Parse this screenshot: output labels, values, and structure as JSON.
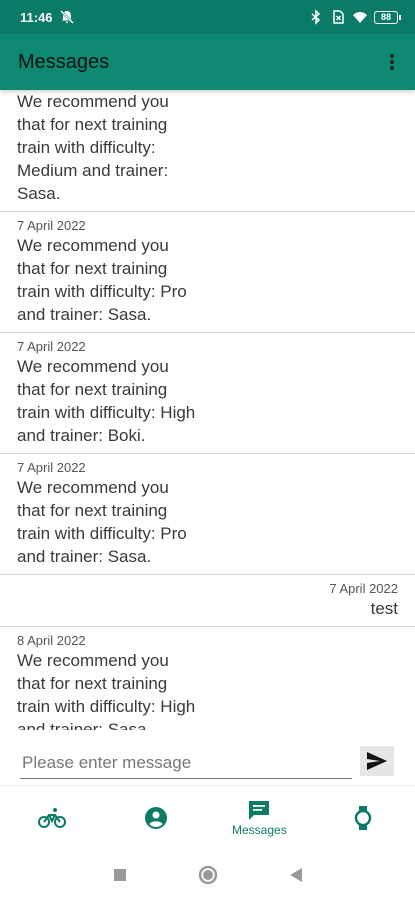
{
  "status_bar": {
    "time": "11:46",
    "battery": "88"
  },
  "app_bar": {
    "title": "Messages"
  },
  "messages": [
    {
      "date": "",
      "text": "We recommend you that for next training train with difficulty: Medium and trainer: Sasa."
    },
    {
      "date": "7 April 2022",
      "text": "We recommend you that for next training train with difficulty: Pro and trainer: Sasa."
    },
    {
      "date": "7 April 2022",
      "text": "We recommend you that for next training train with difficulty: High and trainer: Boki."
    },
    {
      "date": "7 April 2022",
      "text": "We recommend you that for next training train with difficulty: Pro and trainer: Sasa."
    },
    {
      "date": "7 April 2022",
      "text": "test"
    },
    {
      "date": "8 April 2022",
      "text": "We recommend you that for next training train with difficulty: High and trainer: Sasa."
    }
  ],
  "composer": {
    "placeholder": "Please enter message"
  },
  "bottom_nav": {
    "messages_label": "Messages"
  },
  "colors": {
    "primary": "#0e8a73",
    "status_bar": "#0b7a66",
    "accent": "#0b7a66"
  },
  "icons": [
    "bike-icon",
    "profile-icon",
    "messages-icon",
    "watch-icon",
    "send-icon",
    "more-vert-icon"
  ]
}
